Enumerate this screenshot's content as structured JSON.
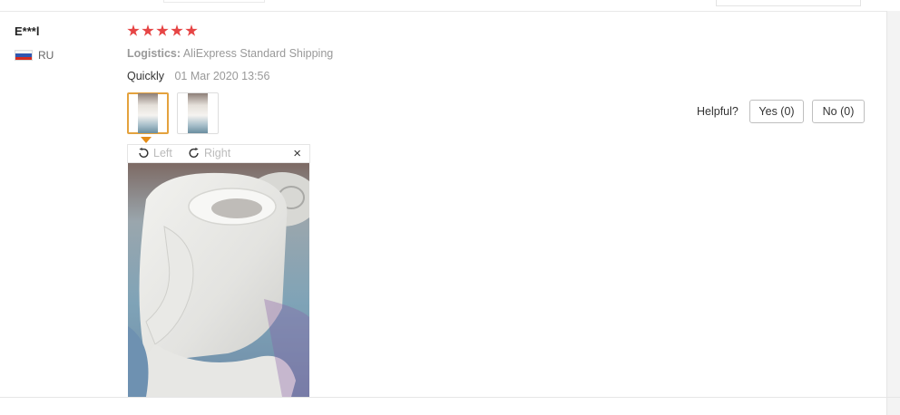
{
  "review": {
    "user_name": "E***l",
    "country": "RU",
    "rating": 5,
    "logistics_label": "Logistics:",
    "logistics_value": "AliExpress Standard Shipping",
    "attribute": "Quickly",
    "date": "01 Mar 2020 13:56"
  },
  "viewer": {
    "rotate_left_label": "Left",
    "rotate_right_label": "Right",
    "close_symbol": "×"
  },
  "helpful": {
    "label": "Helpful?",
    "yes_label": "Yes (0)",
    "no_label": "No (0)"
  },
  "icons": {
    "rating": "star-icon",
    "flag": "russia-flag-icon",
    "rotate_left": "rotate-left-icon",
    "rotate_right": "rotate-right-icon",
    "close": "close-icon"
  },
  "colors": {
    "star": "#e64545",
    "active_thumb_border": "#e4a23d",
    "muted_text": "#999999"
  }
}
